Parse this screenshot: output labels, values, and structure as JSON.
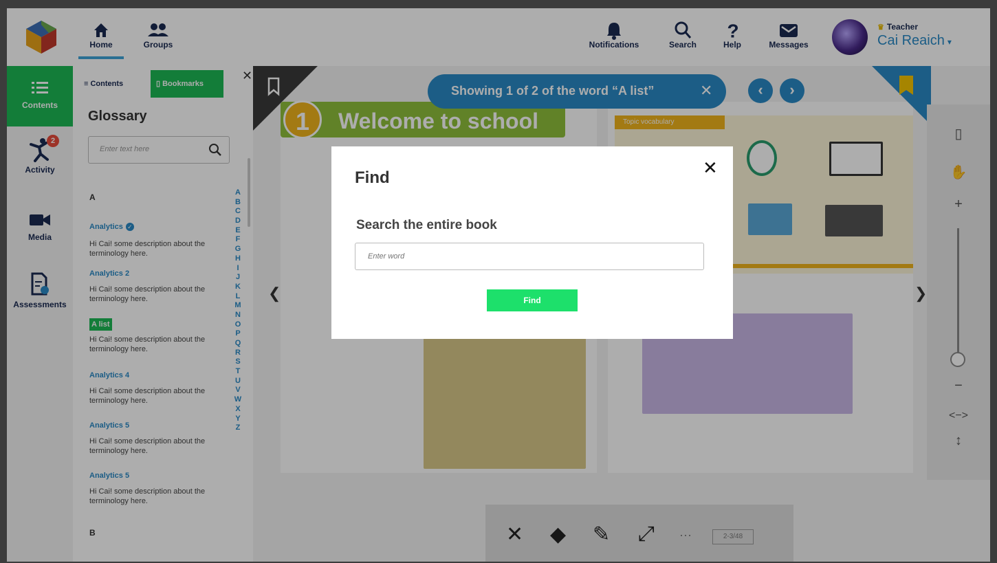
{
  "nav": {
    "home": "Home",
    "groups": "Groups",
    "notifications": "Notifications",
    "search": "Search",
    "help": "Help",
    "messages": "Messages"
  },
  "user": {
    "role": "Teacher",
    "name": "Cai Reaich",
    "dropdown": "▾"
  },
  "rail": {
    "contents": "Contents",
    "activity": "Activity",
    "activity_badge": "2",
    "media": "Media",
    "assessments": "Assessments"
  },
  "panel": {
    "tab_contents": "Contents",
    "tab_bookmarks": "Bookmarks",
    "title": "Glossary",
    "search_placeholder": "Enter text here",
    "letter_a": "A",
    "letter_b": "B",
    "entries": [
      {
        "term": "Analytics",
        "desc": "Hi Cai! some description about the terminology here."
      },
      {
        "term": "Analytics 2",
        "desc": "Hi Cai! some description about the terminology here."
      },
      {
        "term": "A list",
        "desc": "Hi Cai! some description about the terminology here."
      },
      {
        "term": "Analytics 4",
        "desc": "Hi Cai! some description about the terminology here."
      },
      {
        "term": "Analytics 5",
        "desc": "Hi Cai! some description about the terminology here."
      },
      {
        "term": "Analytics 5",
        "desc": "Hi Cai! some description about the terminology here."
      }
    ],
    "alphabet": [
      "A",
      "B",
      "C",
      "D",
      "E",
      "F",
      "G",
      "H",
      "I",
      "J",
      "K",
      "L",
      "M",
      "N",
      "O",
      "P",
      "Q",
      "R",
      "S",
      "T",
      "U",
      "V",
      "W",
      "X",
      "Y",
      "Z"
    ]
  },
  "book": {
    "find_banner": "Showing 1 of 2 of the word “A list”",
    "unit_number": "1",
    "unit_title": "Welcome to school",
    "vocab_header": "Topic vocabulary",
    "page_indicator": "2-3/48"
  },
  "modal": {
    "title": "Find",
    "subtitle": "Search the entire book",
    "input_placeholder": "Enter word",
    "button": "Find"
  },
  "colors": {
    "accent_green": "#1db954",
    "accent_blue": "#2a8ac6",
    "nav_text": "#1a2a52",
    "badge_red": "#e74c3c"
  }
}
